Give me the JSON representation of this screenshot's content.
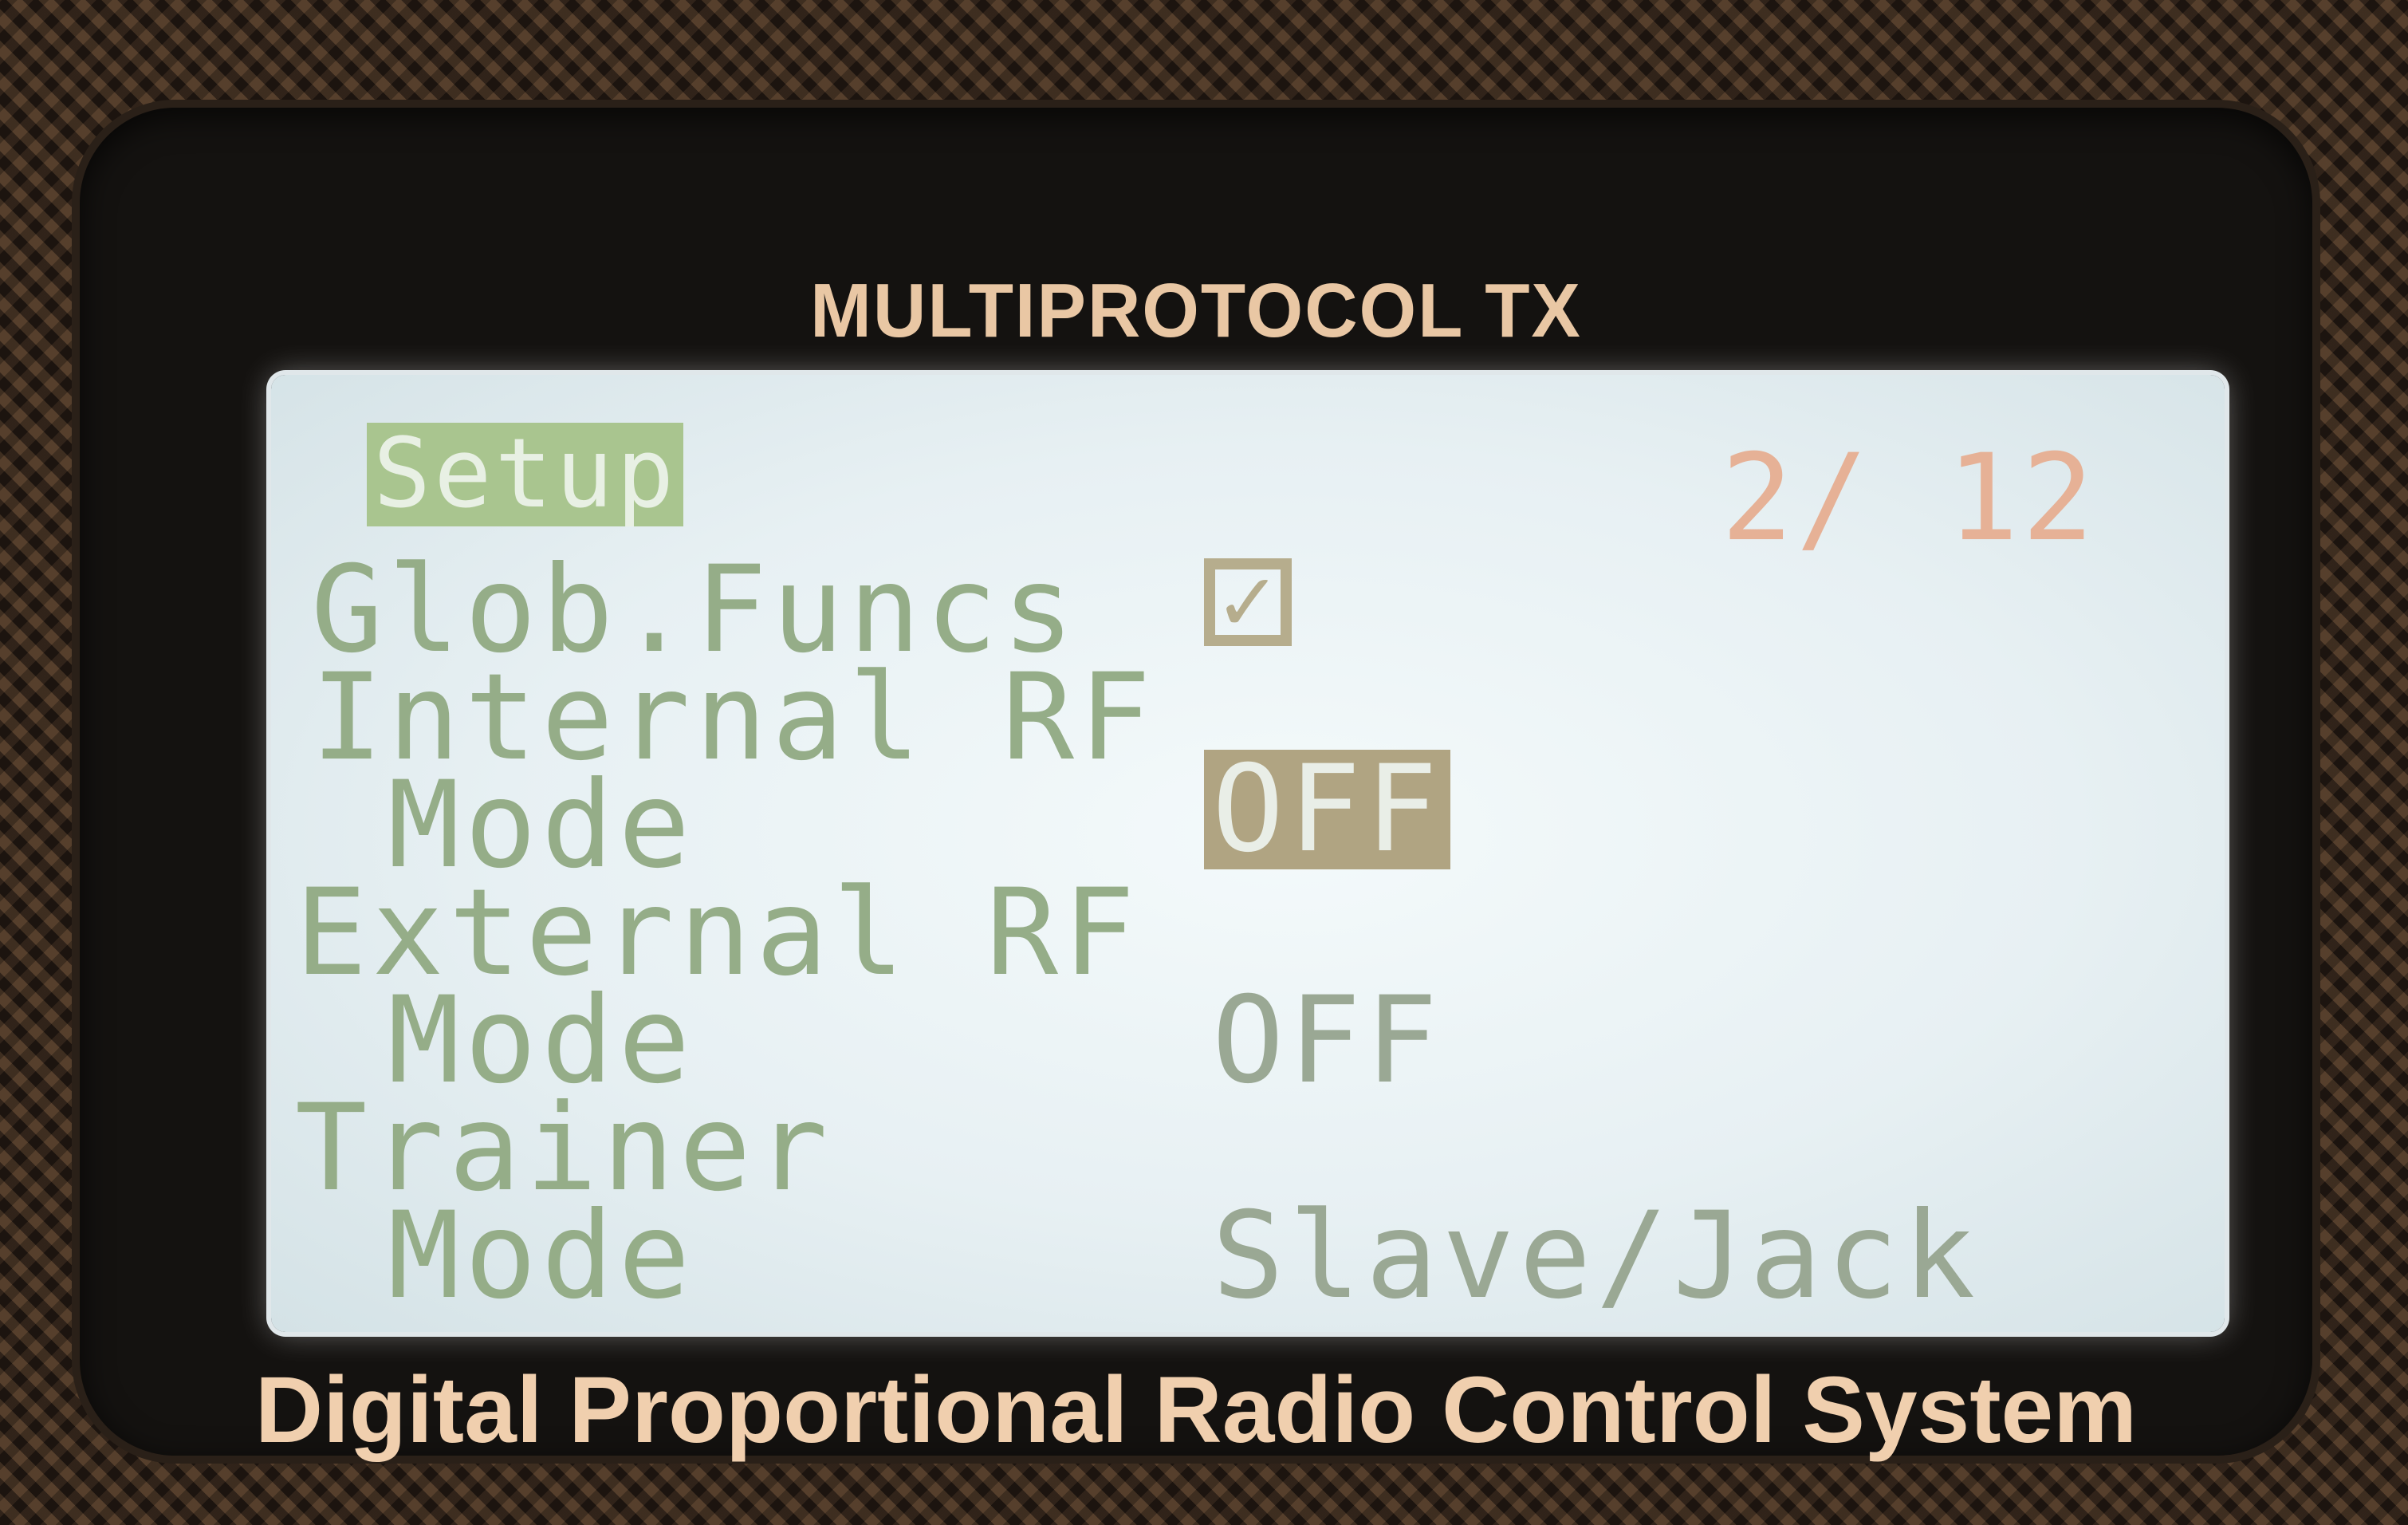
{
  "device": {
    "brand_top": "MULTIPROTOCOL TX",
    "brand_bottom": "Digital Proportional Radio Control System"
  },
  "screen": {
    "title": "Setup",
    "page_indicator": "2/ 12",
    "rows": [
      {
        "label": "Glob.Funcs",
        "value_type": "checkbox",
        "checked": true
      },
      {
        "label": "Internal RF",
        "value": ""
      },
      {
        "label": " Mode",
        "value": "OFF",
        "selected": true
      },
      {
        "label": "External RF",
        "value": ""
      },
      {
        "label": " Mode",
        "value": "OFF",
        "selected": false
      },
      {
        "label": "Trainer",
        "value": ""
      },
      {
        "label": " Mode",
        "value": "Slave/Jack",
        "selected": false
      }
    ]
  },
  "colors": {
    "lcd_background": "#eaf2f4",
    "text_green": "#95ad88",
    "highlight_tan": "#b0a482",
    "page_indicator": "#e6b196",
    "brand_text": "#f0cfae"
  }
}
